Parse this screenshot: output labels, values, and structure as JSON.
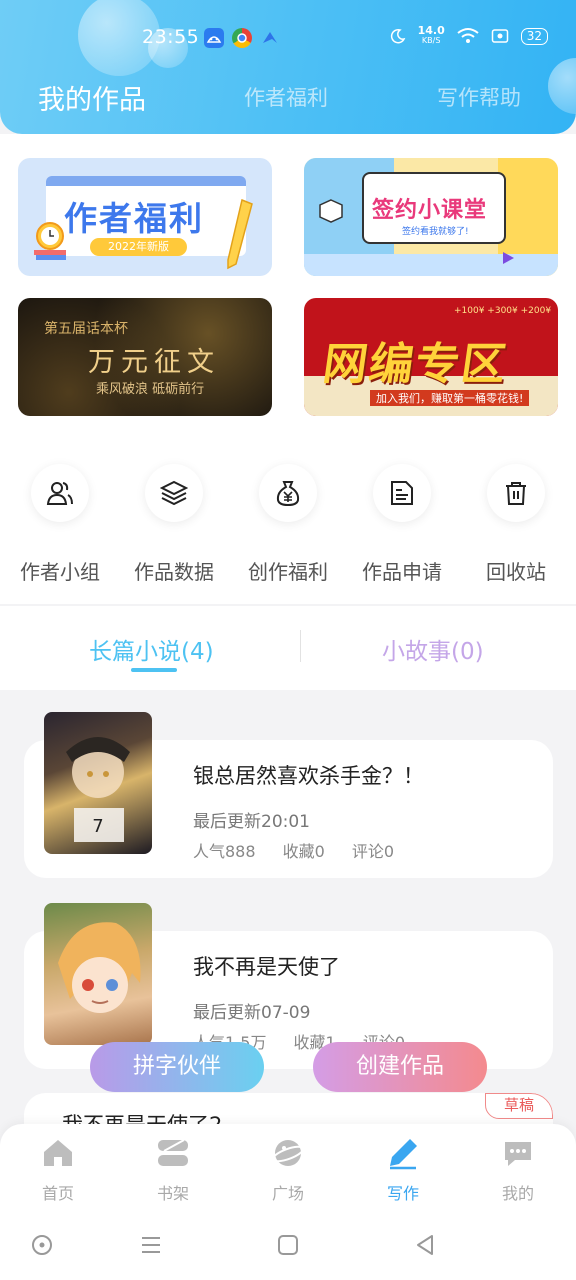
{
  "status_bar": {
    "time": "23:55",
    "net_speed": "14.0",
    "net_speed_unit": "KB/S",
    "battery": "32"
  },
  "header": {
    "tabs": [
      {
        "label": "我的作品",
        "active": true
      },
      {
        "label": "作者福利",
        "active": false
      },
      {
        "label": "写作帮助",
        "active": false
      }
    ]
  },
  "banners": [
    {
      "title": "作者福利",
      "subtitle": "2022年新版"
    },
    {
      "title": "签约小课堂",
      "subtitle": "签约看我就够了!"
    },
    {
      "kicker": "第五届话本杯",
      "title": "万元征文",
      "subtitle": "乘风破浪 砥砺前行"
    },
    {
      "title": "网编专区",
      "subtitle": "加入我们，赚取第一桶零花钱!",
      "amounts": "+100¥  +300¥  +200¥"
    }
  ],
  "actions": [
    {
      "label": "作者小组",
      "icon": "users-icon"
    },
    {
      "label": "作品数据",
      "icon": "layers-icon"
    },
    {
      "label": "创作福利",
      "icon": "money-bag-icon"
    },
    {
      "label": "作品申请",
      "icon": "document-icon"
    },
    {
      "label": "回收站",
      "icon": "trash-icon"
    }
  ],
  "list_tabs": [
    {
      "label": "长篇小说(4)",
      "active": true,
      "color": "#4dc2f2"
    },
    {
      "label": "小故事(0)",
      "active": false,
      "color": "#c4a6e8"
    }
  ],
  "works": [
    {
      "title": "银总居然喜欢杀手金？！",
      "updated": "最后更新20:01",
      "popularity": "人气888",
      "favorites": "收藏0",
      "comments": "评论0"
    },
    {
      "title": "我不再是天使了",
      "updated": "最后更新07-09",
      "popularity": "人气1.5万",
      "favorites": "收藏1",
      "comments": "评论0"
    },
    {
      "title": "我不再是天使了2",
      "badge": "草稿"
    }
  ],
  "floating_buttons": {
    "partner": "拼字伙伴",
    "create": "创建作品"
  },
  "bottom_nav": [
    {
      "label": "首页",
      "icon": "home-icon",
      "active": false
    },
    {
      "label": "书架",
      "icon": "bookshelf-icon",
      "active": false
    },
    {
      "label": "广场",
      "icon": "planet-icon",
      "active": false
    },
    {
      "label": "写作",
      "icon": "pen-icon",
      "active": true
    },
    {
      "label": "我的",
      "icon": "chat-bubble-icon",
      "active": false
    }
  ],
  "colors": {
    "accent": "#3aa6f0",
    "header_gradient_start": "#6fcdf6",
    "header_gradient_end": "#33b3f4",
    "draft_red": "#ea5b5b"
  }
}
